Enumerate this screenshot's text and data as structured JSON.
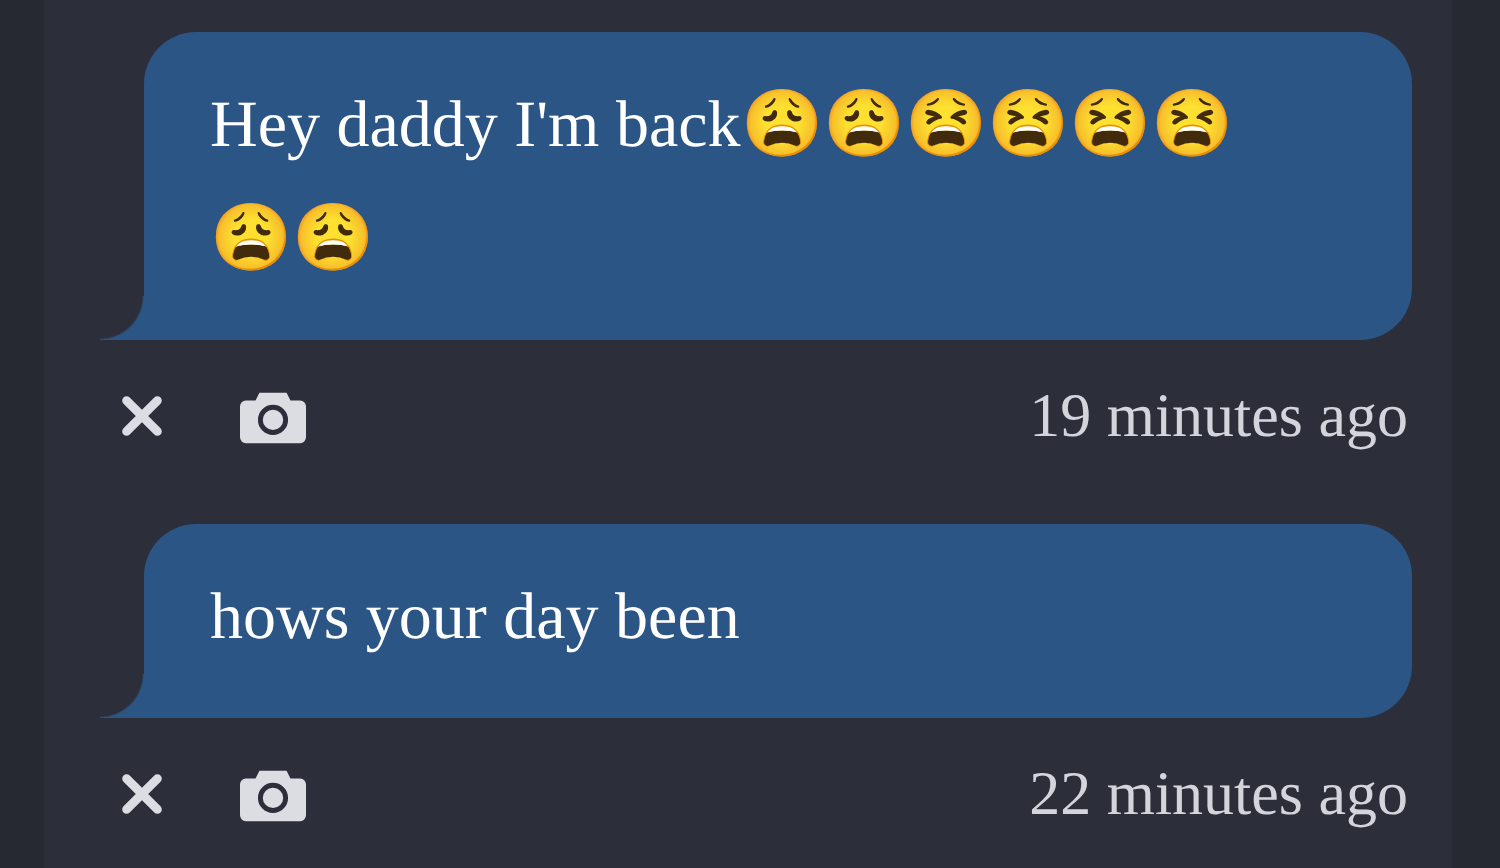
{
  "messages": [
    {
      "text": "Hey daddy I'm back😩😩😫😫😫😫😩😩",
      "time": "19 minutes ago"
    },
    {
      "text": "hows your day been",
      "time": "22 minutes ago"
    }
  ]
}
